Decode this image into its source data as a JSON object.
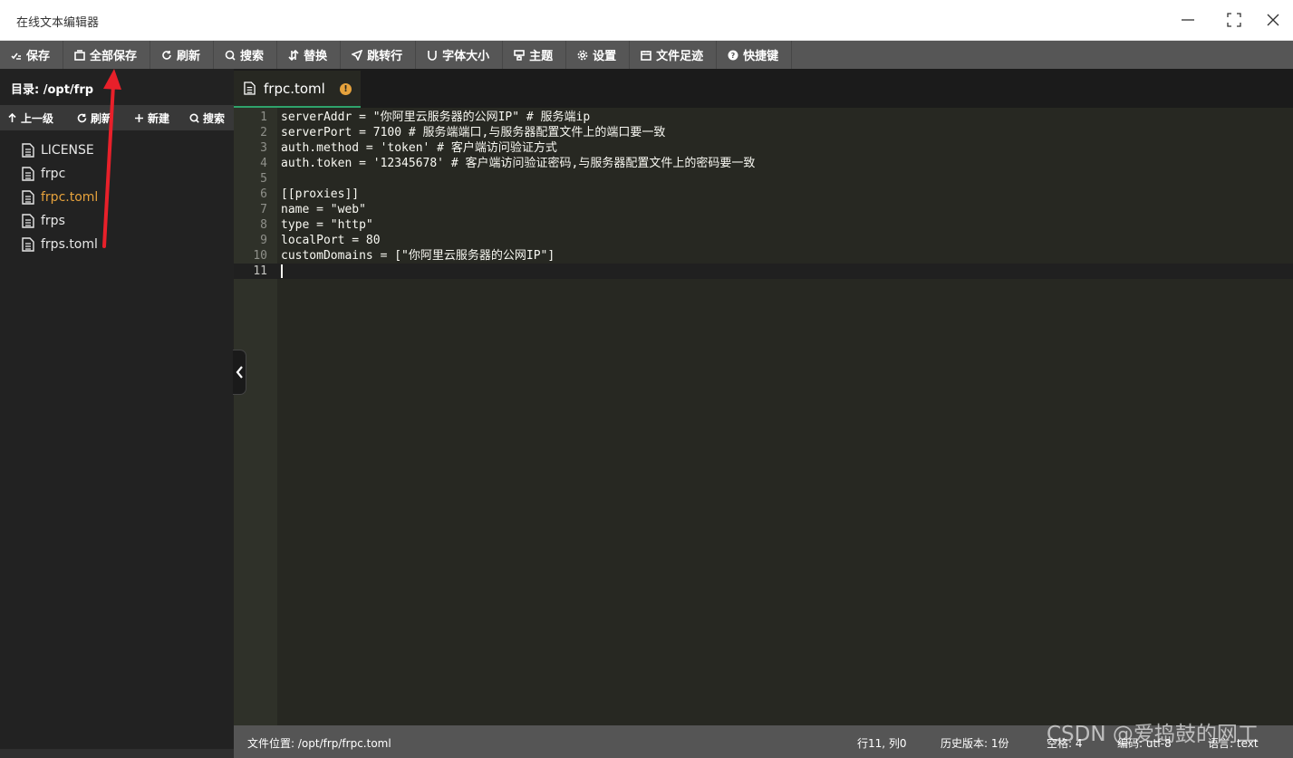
{
  "window": {
    "title": "在线文本编辑器"
  },
  "toolbar": {
    "items": [
      {
        "label": "保存",
        "icon": "save-icon"
      },
      {
        "label": "全部保存",
        "icon": "save-all-icon"
      },
      {
        "label": "刷新",
        "icon": "refresh-icon"
      },
      {
        "label": "搜索",
        "icon": "search-icon"
      },
      {
        "label": "替换",
        "icon": "replace-icon"
      },
      {
        "label": "跳转行",
        "icon": "goto-line-icon"
      },
      {
        "label": "字体大小",
        "icon": "font-size-icon"
      },
      {
        "label": "主题",
        "icon": "theme-icon"
      },
      {
        "label": "设置",
        "icon": "gear-icon"
      },
      {
        "label": "文件足迹",
        "icon": "history-icon"
      },
      {
        "label": "快捷键",
        "icon": "help-icon"
      }
    ]
  },
  "sidebar": {
    "directory_label": "目录: /opt/frp",
    "actions": [
      {
        "label": "上一级",
        "icon": "arrow-up-icon"
      },
      {
        "label": "刷新",
        "icon": "refresh-icon"
      },
      {
        "label": "新建",
        "icon": "plus-icon"
      },
      {
        "label": "搜索",
        "icon": "search-icon"
      }
    ],
    "files": [
      {
        "name": "LICENSE",
        "active": false
      },
      {
        "name": "frpc",
        "active": false
      },
      {
        "name": "frpc.toml",
        "active": true
      },
      {
        "name": "frps",
        "active": false
      },
      {
        "name": "frps.toml",
        "active": false
      }
    ]
  },
  "tab": {
    "label": "frpc.toml",
    "modified_badge": "!"
  },
  "editor": {
    "lines": [
      {
        "n": "1",
        "text": "serverAddr = \"你阿里云服务器的公网IP\" # 服务端ip"
      },
      {
        "n": "2",
        "text": "serverPort = 7100 # 服务端端口,与服务器配置文件上的端口要一致"
      },
      {
        "n": "3",
        "text": "auth.method = 'token' # 客户端访问验证方式"
      },
      {
        "n": "4",
        "text": "auth.token = '12345678' # 客户端访问验证密码,与服务器配置文件上的密码要一致"
      },
      {
        "n": "5",
        "text": ""
      },
      {
        "n": "6",
        "text": "[[proxies]]"
      },
      {
        "n": "7",
        "text": "name = \"web\""
      },
      {
        "n": "8",
        "text": "type = \"http\""
      },
      {
        "n": "9",
        "text": "localPort = 80"
      },
      {
        "n": "10",
        "text": "customDomains = [\"你阿里云服务器的公网IP\"]"
      },
      {
        "n": "11",
        "text": ""
      }
    ],
    "current_line": 11
  },
  "status": {
    "path": "文件位置: /opt/frp/frpc.toml",
    "position": "行11, 列0",
    "history": "历史版本: 1份",
    "indent": "空格: 4",
    "encoding": "编码: utf-8",
    "language": "语言: text"
  },
  "watermark": "CSDN @爱捣鼓的网工",
  "colors": {
    "accent_active_file": "#e6a23c",
    "tab_underline": "#2fa36b",
    "annotation_arrow": "#e8202a"
  }
}
